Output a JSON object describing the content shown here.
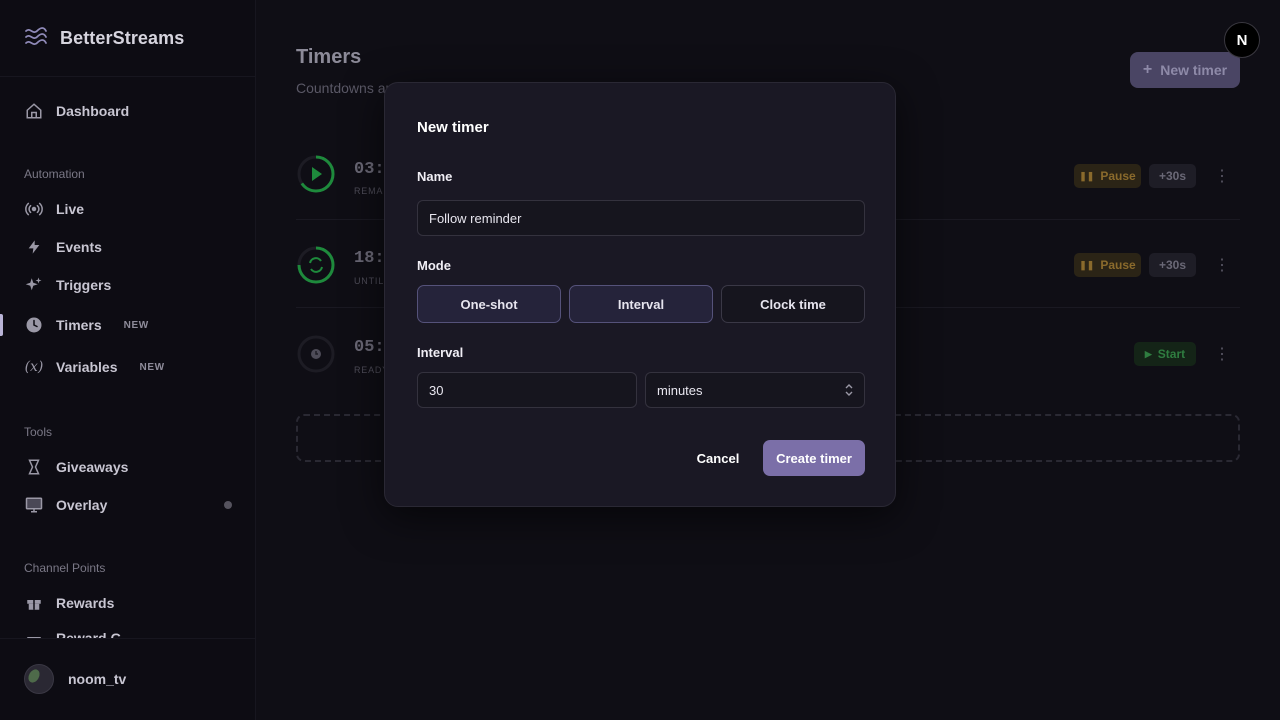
{
  "brand": {
    "name": "BetterStreams",
    "icon": "waves-icon"
  },
  "sidebar": {
    "dashboard": "Dashboard",
    "sections": {
      "automation": "Automation",
      "tools": "Tools",
      "channel_points": "Channel Points"
    },
    "items": [
      {
        "label": "Live",
        "icon": "broadcast-icon"
      },
      {
        "label": "Events",
        "icon": "bolt-icon"
      },
      {
        "label": "Triggers",
        "icon": "sparkles-icon"
      },
      {
        "label": "Timers",
        "icon": "clock-icon",
        "badge": "NEW",
        "active": true
      },
      {
        "label": "Variables",
        "icon": "variable-icon",
        "badge": "NEW"
      },
      {
        "label": "Giveaways",
        "icon": "trophy-icon"
      },
      {
        "label": "Overlay",
        "icon": "monitor-icon"
      },
      {
        "label": "Rewards",
        "icon": "gift-icon"
      },
      {
        "label": "Reward G...",
        "icon": "gift-icon"
      }
    ],
    "user": {
      "name": "noom_tv"
    }
  },
  "main": {
    "title": "Timers",
    "subtitle": "Countdowns ar",
    "new_timer_button": "New timer",
    "profile_initial": "N",
    "timers": [
      {
        "time": "03:",
        "state": "REMAI",
        "actions": [
          "Pause",
          "+30s"
        ]
      },
      {
        "time": "18:",
        "state": "UNTIL",
        "actions": [
          "Pause",
          "+30s"
        ]
      },
      {
        "time": "05:",
        "state": "READY",
        "actions": [
          "Start"
        ]
      }
    ]
  },
  "modal": {
    "title": "New timer",
    "name_label": "Name",
    "name_value": "Follow reminder",
    "mode_label": "Mode",
    "modes": [
      "One-shot",
      "Interval",
      "Clock time"
    ],
    "interval_label": "Interval",
    "interval_value": "30",
    "interval_unit": "minutes",
    "cancel": "Cancel",
    "create": "Create timer"
  },
  "colors": {
    "accent": "#7b6fa8",
    "pause": "#8a6a2c",
    "start": "#2f7d40",
    "ring_green": "#1e8a3c"
  }
}
